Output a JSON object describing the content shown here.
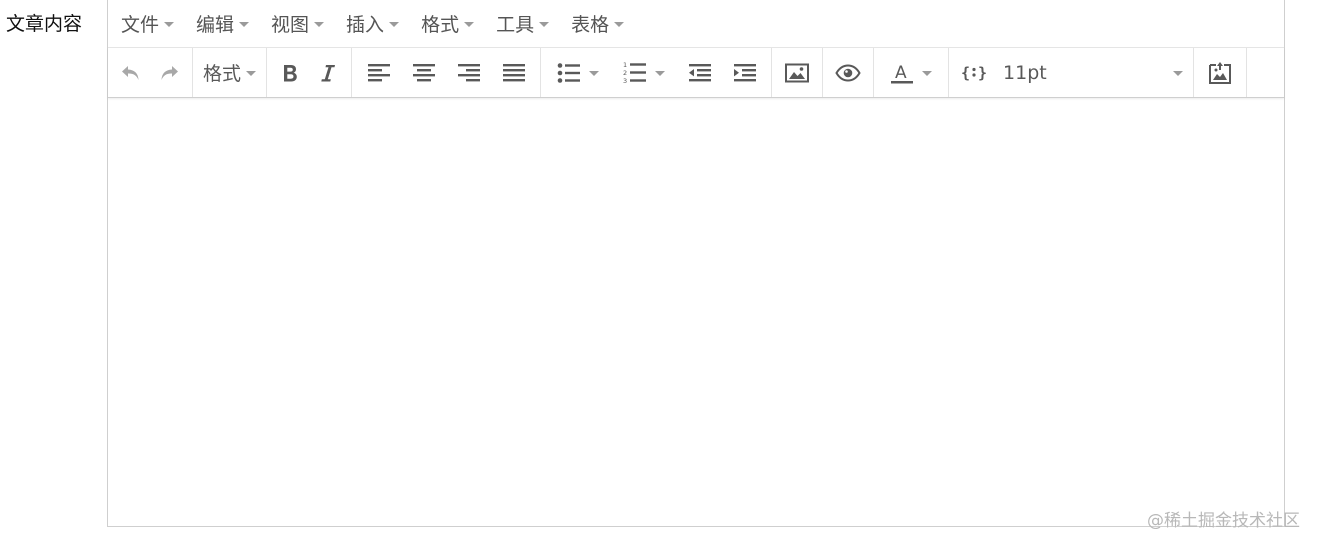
{
  "field": {
    "label": "文章内容"
  },
  "menubar": {
    "items": [
      {
        "label": "文件"
      },
      {
        "label": "编辑"
      },
      {
        "label": "视图"
      },
      {
        "label": "插入"
      },
      {
        "label": "格式"
      },
      {
        "label": "工具"
      },
      {
        "label": "表格"
      }
    ]
  },
  "toolbar": {
    "format_label": "格式",
    "font_size_value": "11pt",
    "icons": {
      "undo": "undo-icon",
      "redo": "redo-icon",
      "bold": "bold-icon",
      "italic": "italic-icon",
      "align_left": "align-left-icon",
      "align_center": "align-center-icon",
      "align_right": "align-right-icon",
      "align_justify": "align-justify-icon",
      "bullet_list": "bullet-list-icon",
      "numbered_list": "numbered-list-icon",
      "outdent": "outdent-icon",
      "indent": "indent-icon",
      "image": "image-icon",
      "preview": "eye-icon",
      "text_color": "text-color-icon",
      "code": "code-sample-icon",
      "upload_image": "image-upload-icon"
    }
  },
  "watermark": {
    "text": "@稀土掘金技术社区"
  },
  "colors": {
    "icon": "#595959",
    "disabled_icon": "#a8a8a8",
    "border": "#cfcfcf",
    "caret": "#9a9a9a"
  }
}
